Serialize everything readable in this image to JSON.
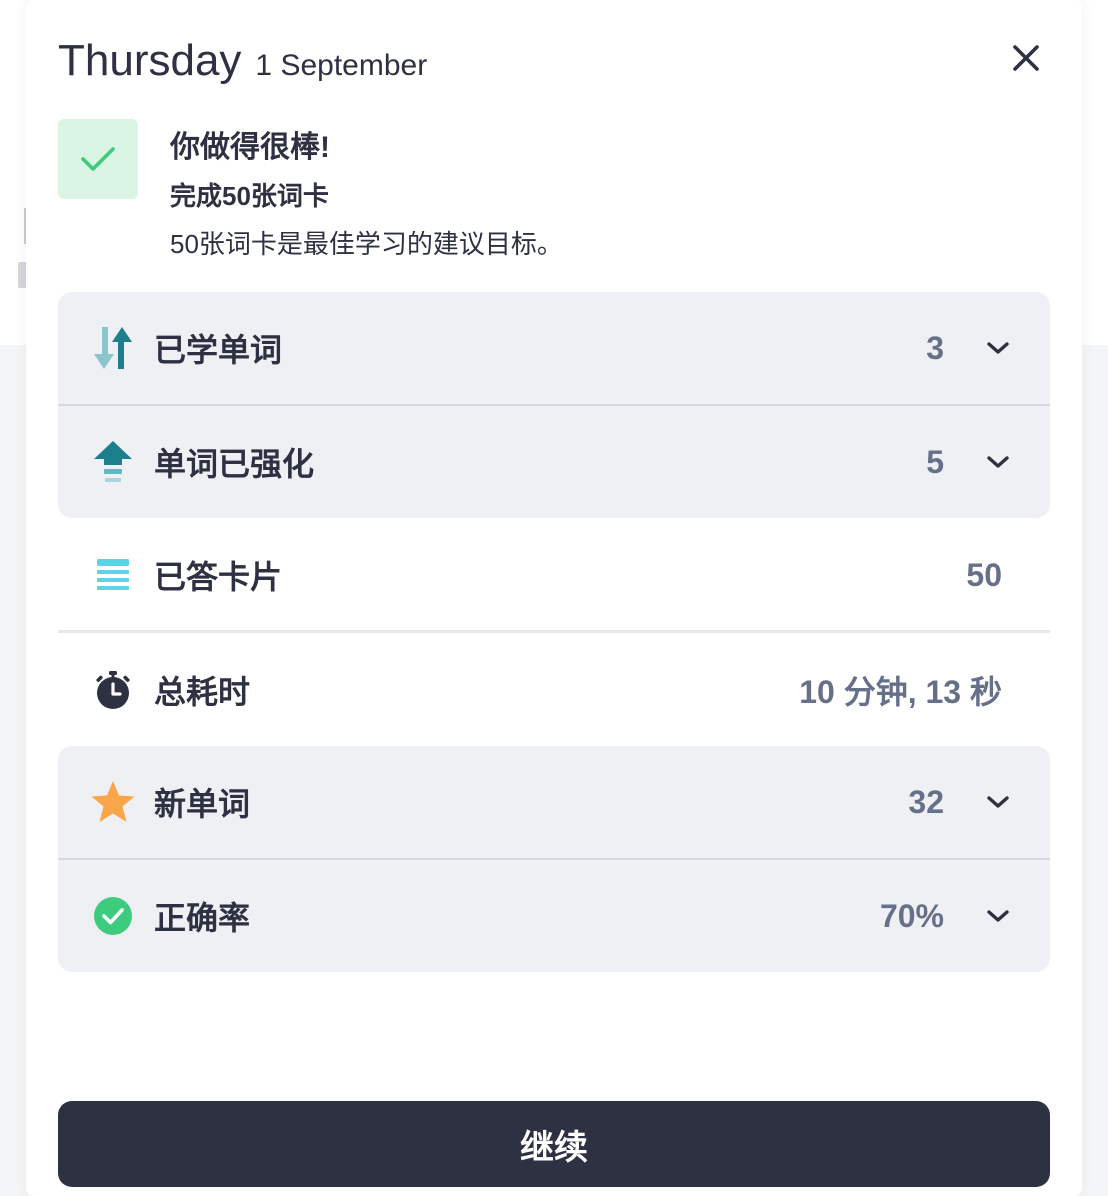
{
  "header": {
    "day": "Thursday",
    "date": "1 September"
  },
  "message": {
    "title": "你做得很棒!",
    "subtitle": "完成50张词卡",
    "description": "50张词卡是最佳学习的建议目标。"
  },
  "stats": {
    "learned": {
      "label": "已学单词",
      "value": "3",
      "icon": "learned-arrows-icon"
    },
    "strengthened": {
      "label": "单词已强化",
      "value": "5",
      "icon": "strengthen-up-arrow-icon"
    },
    "answered": {
      "label": "已答卡片",
      "value": "50",
      "icon": "card-stack-icon"
    },
    "time": {
      "label": "总耗时",
      "value": "10 分钟, 13 秒",
      "icon": "stopwatch-icon"
    },
    "new_words": {
      "label": "新单词",
      "value": "32",
      "icon": "star-icon"
    },
    "accuracy": {
      "label": "正确率",
      "value": "70%",
      "icon": "check-circle-icon"
    }
  },
  "continue_label": "继续",
  "colors": {
    "primary_dark": "#2d3142",
    "value_gray": "#667089",
    "success_green": "#3dcc7e",
    "success_bg": "#daf5e5",
    "teal": "#1d7e8c",
    "cyan": "#5fd3e6",
    "star_orange": "#f9a54a",
    "row_bg": "#eff0f4"
  }
}
